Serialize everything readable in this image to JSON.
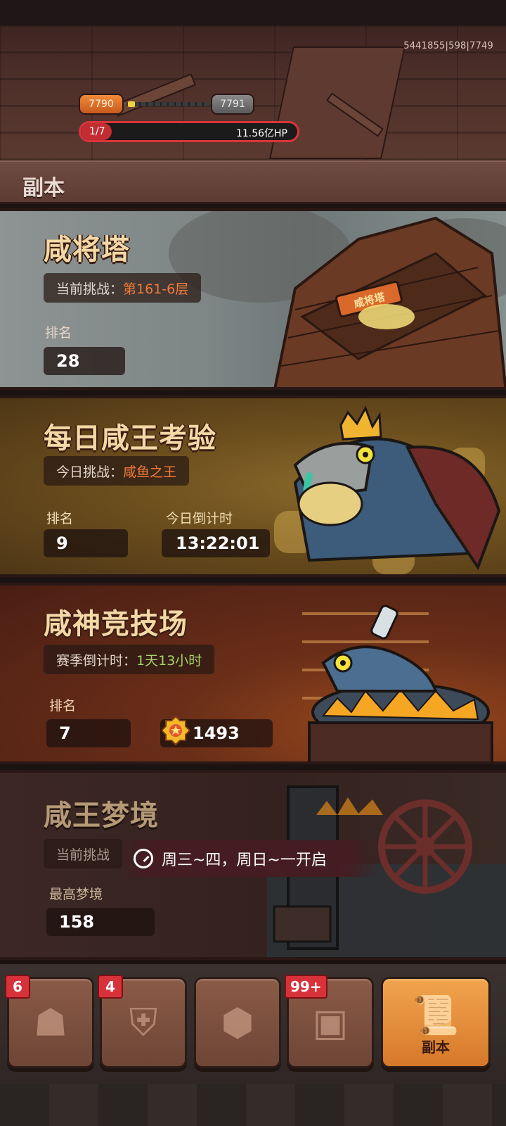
{
  "header": {
    "user_info": "5441855|598|7749",
    "level_current": "7790",
    "level_next": "7791",
    "level_progress": 0.06,
    "hp_progress_text": "1/7",
    "hp_progress": 0.142,
    "hp_value": "11.56亿HP"
  },
  "section": {
    "title": "副本"
  },
  "cards": {
    "tower": {
      "title": "咸将塔",
      "challenge_label": "当前挑战：",
      "challenge_value": "第161-6层",
      "rank_label": "排名",
      "rank_value": "28",
      "sign_text": "咸将塔"
    },
    "daily": {
      "title": "每日咸王考验",
      "challenge_label": "今日挑战：",
      "challenge_value": "咸鱼之王",
      "rank_label": "排名",
      "rank_value": "9",
      "countdown_label": "今日倒计时",
      "countdown_value": "13:22:01"
    },
    "arena": {
      "title": "咸神竞技场",
      "season_label": "赛季倒计时：",
      "season_value": "1天13小时",
      "rank_label": "排名",
      "rank_value": "7",
      "score_value": "1493"
    },
    "dream": {
      "title": "咸王梦境",
      "challenge_label": "当前挑战",
      "locked_text": "周三~四，周日~一开启",
      "best_label": "最高梦境",
      "best_value": "158"
    }
  },
  "bottom_nav": [
    {
      "icon": "hero-icon",
      "badge": "6",
      "label": ""
    },
    {
      "icon": "armor-icon",
      "badge": "4",
      "label": ""
    },
    {
      "icon": "turtle-icon",
      "badge": "",
      "label": ""
    },
    {
      "icon": "chest-icon",
      "badge": "99+",
      "label": ""
    },
    {
      "icon": "scroll-icon",
      "badge": "",
      "label": "副本"
    }
  ],
  "colors": {
    "accent_orange": "#f27a3a",
    "accent_green": "#a6d36b",
    "hp_red": "#d9343a",
    "active_tab": "#f2a44d"
  }
}
